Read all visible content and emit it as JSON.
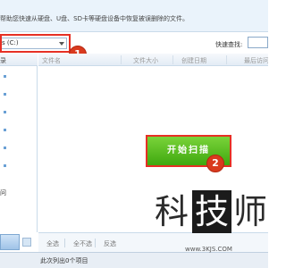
{
  "banner": {
    "text": "帮助您快速从硬盘、U盘、SD卡等硬盘设备中恢复被误删除的文件。"
  },
  "drive_select": {
    "value": "s (C:)"
  },
  "markers": [
    "1",
    "2"
  ],
  "quick_search": {
    "label": "快速查找:",
    "value": ""
  },
  "left_panel": {
    "header": "录",
    "tree_label": "问"
  },
  "columns": [
    "文件名",
    "文件大小",
    "创建日期",
    "最后访问"
  ],
  "scan_button": {
    "label": "开始扫描"
  },
  "actions": [
    "全选",
    "全不选",
    "反选"
  ],
  "status": {
    "text": "此次列出0个项目"
  },
  "watermark": {
    "chars": [
      "科",
      "技",
      "师"
    ],
    "url": "www.3KJS.COM"
  },
  "colors": {
    "highlight_red": "#e63025",
    "scan_green": "#4db51b",
    "marker_red": "#d93a1e"
  }
}
